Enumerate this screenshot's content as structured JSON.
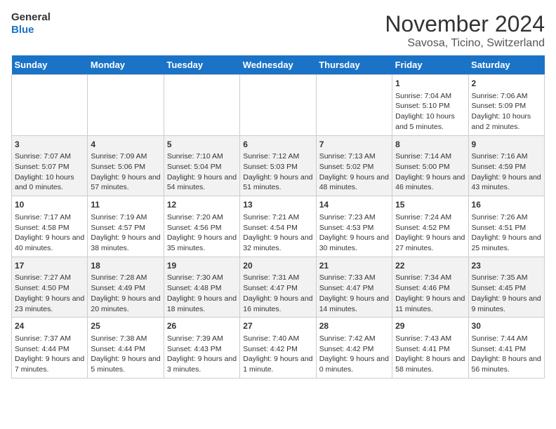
{
  "logo": {
    "line1": "General",
    "line2": "Blue"
  },
  "title": "November 2024",
  "subtitle": "Savosa, Ticino, Switzerland",
  "weekdays": [
    "Sunday",
    "Monday",
    "Tuesday",
    "Wednesday",
    "Thursday",
    "Friday",
    "Saturday"
  ],
  "weeks": [
    [
      {
        "day": "",
        "text": ""
      },
      {
        "day": "",
        "text": ""
      },
      {
        "day": "",
        "text": ""
      },
      {
        "day": "",
        "text": ""
      },
      {
        "day": "",
        "text": ""
      },
      {
        "day": "1",
        "text": "Sunrise: 7:04 AM\nSunset: 5:10 PM\nDaylight: 10 hours and 5 minutes."
      },
      {
        "day": "2",
        "text": "Sunrise: 7:06 AM\nSunset: 5:09 PM\nDaylight: 10 hours and 2 minutes."
      }
    ],
    [
      {
        "day": "3",
        "text": "Sunrise: 7:07 AM\nSunset: 5:07 PM\nDaylight: 10 hours and 0 minutes."
      },
      {
        "day": "4",
        "text": "Sunrise: 7:09 AM\nSunset: 5:06 PM\nDaylight: 9 hours and 57 minutes."
      },
      {
        "day": "5",
        "text": "Sunrise: 7:10 AM\nSunset: 5:04 PM\nDaylight: 9 hours and 54 minutes."
      },
      {
        "day": "6",
        "text": "Sunrise: 7:12 AM\nSunset: 5:03 PM\nDaylight: 9 hours and 51 minutes."
      },
      {
        "day": "7",
        "text": "Sunrise: 7:13 AM\nSunset: 5:02 PM\nDaylight: 9 hours and 48 minutes."
      },
      {
        "day": "8",
        "text": "Sunrise: 7:14 AM\nSunset: 5:00 PM\nDaylight: 9 hours and 46 minutes."
      },
      {
        "day": "9",
        "text": "Sunrise: 7:16 AM\nSunset: 4:59 PM\nDaylight: 9 hours and 43 minutes."
      }
    ],
    [
      {
        "day": "10",
        "text": "Sunrise: 7:17 AM\nSunset: 4:58 PM\nDaylight: 9 hours and 40 minutes."
      },
      {
        "day": "11",
        "text": "Sunrise: 7:19 AM\nSunset: 4:57 PM\nDaylight: 9 hours and 38 minutes."
      },
      {
        "day": "12",
        "text": "Sunrise: 7:20 AM\nSunset: 4:56 PM\nDaylight: 9 hours and 35 minutes."
      },
      {
        "day": "13",
        "text": "Sunrise: 7:21 AM\nSunset: 4:54 PM\nDaylight: 9 hours and 32 minutes."
      },
      {
        "day": "14",
        "text": "Sunrise: 7:23 AM\nSunset: 4:53 PM\nDaylight: 9 hours and 30 minutes."
      },
      {
        "day": "15",
        "text": "Sunrise: 7:24 AM\nSunset: 4:52 PM\nDaylight: 9 hours and 27 minutes."
      },
      {
        "day": "16",
        "text": "Sunrise: 7:26 AM\nSunset: 4:51 PM\nDaylight: 9 hours and 25 minutes."
      }
    ],
    [
      {
        "day": "17",
        "text": "Sunrise: 7:27 AM\nSunset: 4:50 PM\nDaylight: 9 hours and 23 minutes."
      },
      {
        "day": "18",
        "text": "Sunrise: 7:28 AM\nSunset: 4:49 PM\nDaylight: 9 hours and 20 minutes."
      },
      {
        "day": "19",
        "text": "Sunrise: 7:30 AM\nSunset: 4:48 PM\nDaylight: 9 hours and 18 minutes."
      },
      {
        "day": "20",
        "text": "Sunrise: 7:31 AM\nSunset: 4:47 PM\nDaylight: 9 hours and 16 minutes."
      },
      {
        "day": "21",
        "text": "Sunrise: 7:33 AM\nSunset: 4:47 PM\nDaylight: 9 hours and 14 minutes."
      },
      {
        "day": "22",
        "text": "Sunrise: 7:34 AM\nSunset: 4:46 PM\nDaylight: 9 hours and 11 minutes."
      },
      {
        "day": "23",
        "text": "Sunrise: 7:35 AM\nSunset: 4:45 PM\nDaylight: 9 hours and 9 minutes."
      }
    ],
    [
      {
        "day": "24",
        "text": "Sunrise: 7:37 AM\nSunset: 4:44 PM\nDaylight: 9 hours and 7 minutes."
      },
      {
        "day": "25",
        "text": "Sunrise: 7:38 AM\nSunset: 4:44 PM\nDaylight: 9 hours and 5 minutes."
      },
      {
        "day": "26",
        "text": "Sunrise: 7:39 AM\nSunset: 4:43 PM\nDaylight: 9 hours and 3 minutes."
      },
      {
        "day": "27",
        "text": "Sunrise: 7:40 AM\nSunset: 4:42 PM\nDaylight: 9 hours and 1 minute."
      },
      {
        "day": "28",
        "text": "Sunrise: 7:42 AM\nSunset: 4:42 PM\nDaylight: 9 hours and 0 minutes."
      },
      {
        "day": "29",
        "text": "Sunrise: 7:43 AM\nSunset: 4:41 PM\nDaylight: 8 hours and 58 minutes."
      },
      {
        "day": "30",
        "text": "Sunrise: 7:44 AM\nSunset: 4:41 PM\nDaylight: 8 hours and 56 minutes."
      }
    ]
  ]
}
